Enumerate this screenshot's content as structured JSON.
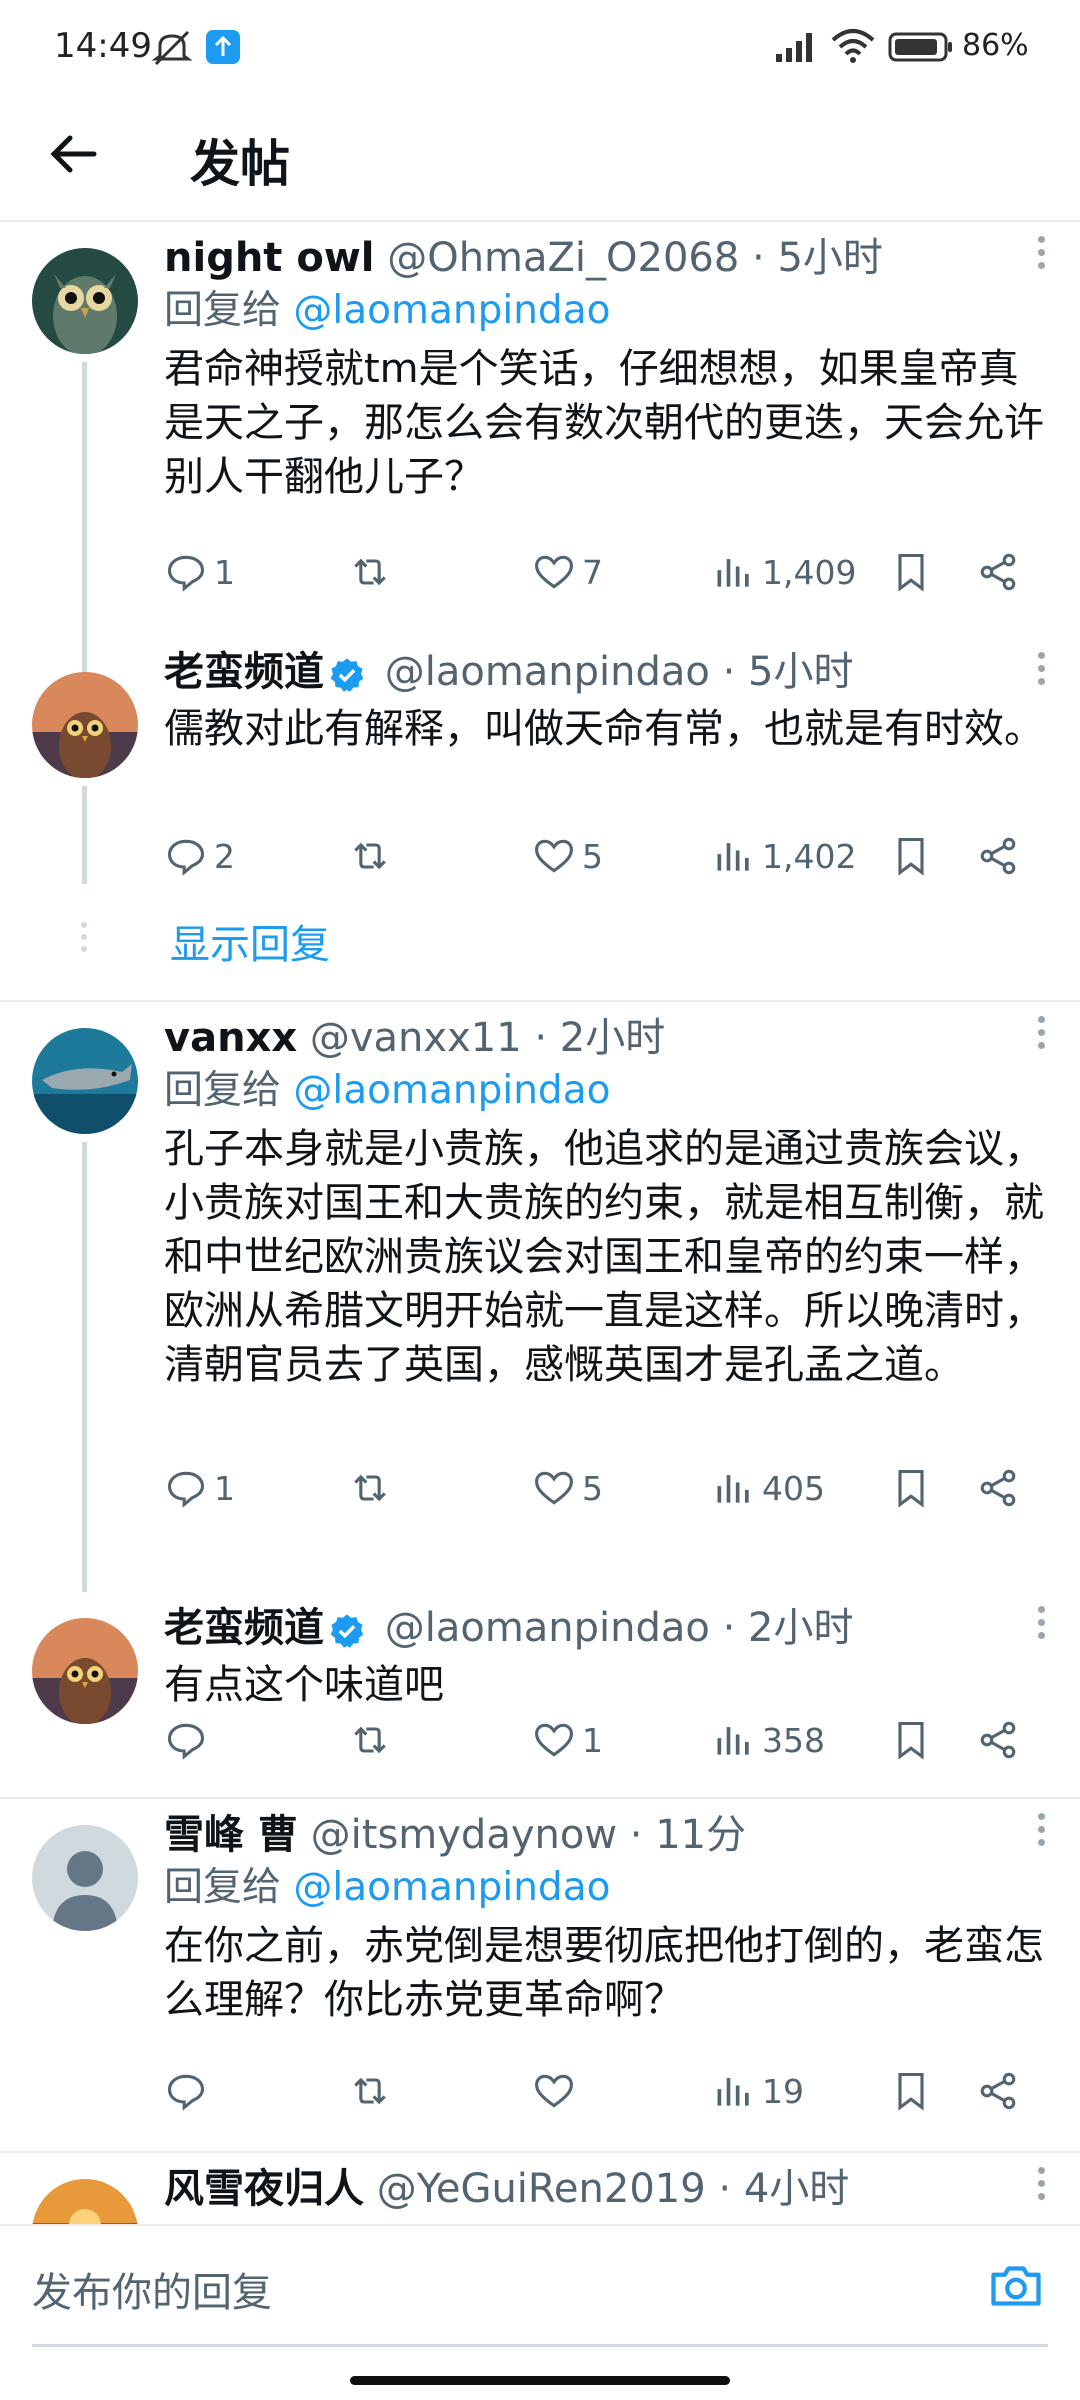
{
  "status_bar": {
    "time": "14:49",
    "battery": "86%"
  },
  "header": {
    "title": "发帖"
  },
  "tweets": [
    {
      "name": "night owl",
      "handle": "@OhmaZi_O2068",
      "time": "· 5小时",
      "reply_label": "回复给",
      "reply_handle": "@laomanpindao",
      "text": "君命神授就tm是个笑话，仔细想想，如果皇帝真是天之子，那怎么会有数次朝代的更迭，天会允许别人干翻他儿子？",
      "replies": "1",
      "retweets": "",
      "likes": "7",
      "views": "1,409"
    },
    {
      "name": "老蛮频道",
      "verified": true,
      "handle": "@laomanpindao",
      "time": "· 5小时",
      "text": "儒教对此有解释，叫做天命有常，也就是有时效。",
      "replies": "2",
      "retweets": "",
      "likes": "5",
      "views": "1,402"
    },
    {
      "name": "vanxx",
      "handle": "@vanxx11",
      "time": "· 2小时",
      "reply_label": "回复给",
      "reply_handle": "@laomanpindao",
      "text": "孔子本身就是小贵族，他追求的是通过贵族会议，小贵族对国王和大贵族的约束，就是相互制衡，就和中世纪欧洲贵族议会对国王和皇帝的约束一样，欧洲从希腊文明开始就一直是这样。所以晚清时，清朝官员去了英国，感慨英国才是孔孟之道。",
      "replies": "1",
      "retweets": "",
      "likes": "5",
      "views": "405"
    },
    {
      "name": "老蛮频道",
      "verified": true,
      "handle": "@laomanpindao",
      "time": "· 2小时",
      "text": "有点这个味道吧",
      "replies": "",
      "retweets": "",
      "likes": "1",
      "views": "358"
    },
    {
      "name": "雪峰 曹",
      "handle": "@itsmydaynow",
      "time": "· 11分",
      "reply_label": "回复给",
      "reply_handle": "@laomanpindao",
      "text": "在你之前，赤党倒是想要彻底把他打倒的，老蛮怎么理解？你比赤党更革命啊？",
      "replies": "",
      "retweets": "",
      "likes": "",
      "views": "19"
    },
    {
      "name": "风雪夜归人",
      "handle": "@YeGuiRen2019",
      "time": "· 4小时"
    }
  ],
  "show_replies": "显示回复",
  "reply_bar": {
    "placeholder": "发布你的回复"
  },
  "colors": {
    "accent": "#1d9bf0",
    "secondary_text": "#536471",
    "divider": "#e6ecf0"
  }
}
